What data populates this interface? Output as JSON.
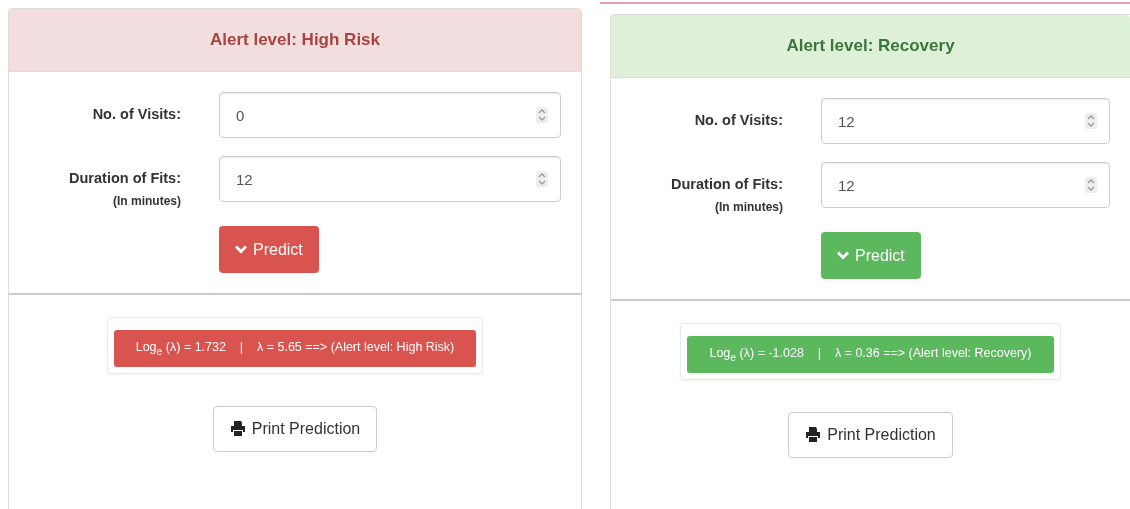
{
  "panels": [
    {
      "kind": "danger",
      "title": "Alert level: High Risk",
      "fields": [
        {
          "label": "No. of Visits:",
          "value": "0"
        },
        {
          "label": "Duration of Fits:",
          "note": "(In minutes)",
          "value": "12"
        }
      ],
      "predict_button": "Predict",
      "result": "Log$_{e}$ (λ) = 1.732    |    λ = 5.65 ==> (Alert level: High Risk)",
      "print_button": "Print Prediction"
    },
    {
      "kind": "success",
      "title": "Alert level: Recovery",
      "fields": [
        {
          "label": "No. of Visits:",
          "value": "12"
        },
        {
          "label": "Duration of Fits:",
          "note": "(In minutes)",
          "value": "12"
        }
      ],
      "predict_button": "Predict",
      "result": "Log$_{e}$ (λ) = -1.028    |    λ = 0.36 ==> (Alert level: Recovery)",
      "print_button": "Print Prediction"
    }
  ]
}
